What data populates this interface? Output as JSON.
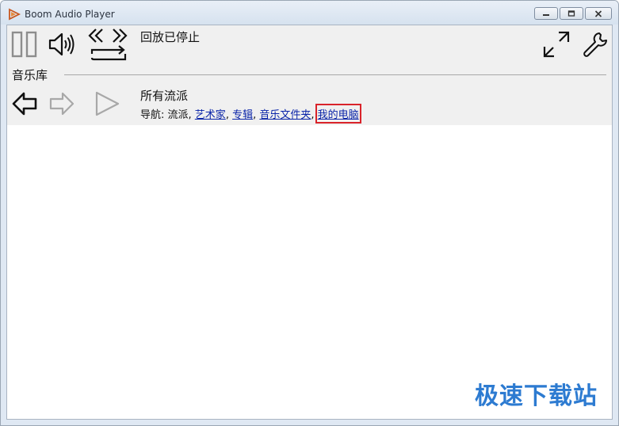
{
  "window": {
    "title": "Boom Audio Player"
  },
  "toolbar": {
    "status": "回放已停止"
  },
  "library": {
    "section_label": "音乐库",
    "current_view": "所有流派",
    "breadcrumb": {
      "prefix": "导航: ",
      "current": "流派",
      "separator": ", ",
      "links": [
        "艺术家",
        "专辑",
        "音乐文件夹",
        "我的电脑"
      ]
    }
  },
  "watermark": {
    "text": "极速下载站"
  },
  "colors": {
    "link": "#0a24a8",
    "highlight": "#d9232a",
    "watermark": "#2d7bd1"
  }
}
